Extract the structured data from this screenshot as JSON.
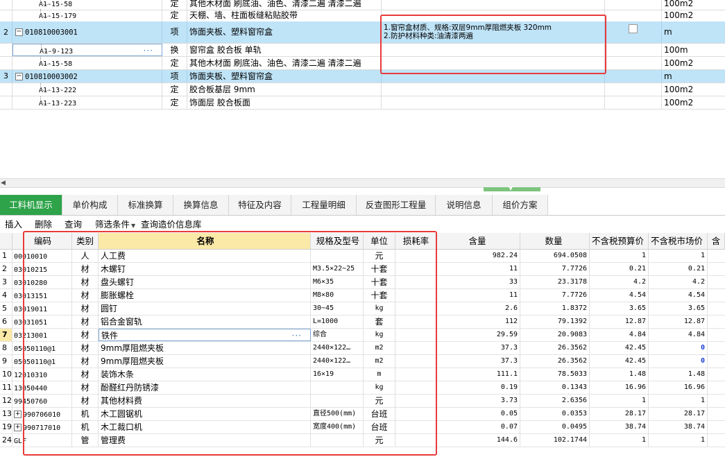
{
  "upper": {
    "rows": [
      {
        "no": "",
        "code": "A1-15-58",
        "type": "定",
        "name": "其他木材面 刷底油、油色、清漆二遍 清漆二遍",
        "feature": "",
        "unit": "100m2",
        "level": "child"
      },
      {
        "no": "",
        "code": "A1-15-179",
        "type": "定",
        "name": "天棚、墙、柱面板缝粘贴胶带",
        "feature": "",
        "unit": "100m2",
        "level": "child"
      },
      {
        "no": "2",
        "code": "010810003001",
        "type": "项",
        "name": "饰面夹板、塑料窗帘盒",
        "feature": "1.窗帘盒材质、规格:双层9mm厚阻燃夹板 320mm\n2.防护材料种类:油清漆两遍",
        "unit": "m",
        "level": "parent"
      },
      {
        "no": "",
        "code": "A1-9-123",
        "type": "换",
        "name": "窗帘盒 胶合板 单轨",
        "feature": "",
        "unit": "100m",
        "level": "child"
      },
      {
        "no": "",
        "code": "A1-15-58",
        "type": "定",
        "name": "其他木材面 刷底油、油色、清漆二遍 清漆二遍",
        "feature": "",
        "unit": "100m2",
        "level": "child"
      },
      {
        "no": "3",
        "code": "010810003002",
        "type": "项",
        "name": "饰面夹板、塑料窗帘盒",
        "feature": "",
        "unit": "m",
        "level": "parent"
      },
      {
        "no": "",
        "code": "A1-13-222",
        "type": "定",
        "name": "胶合板基层 9mm",
        "feature": "",
        "unit": "100m2",
        "level": "child"
      },
      {
        "no": "",
        "code": "A1-13-223",
        "type": "定",
        "name": "饰面层 胶合板面",
        "feature": "",
        "unit": "100m2",
        "level": "child"
      }
    ]
  },
  "tabs": [
    {
      "label": "工料机显示",
      "active": true
    },
    {
      "label": "单价构成"
    },
    {
      "label": "标准换算"
    },
    {
      "label": "换算信息"
    },
    {
      "label": "特征及内容"
    },
    {
      "label": "工程量明细"
    },
    {
      "label": "反查图形工程量"
    },
    {
      "label": "说明信息"
    },
    {
      "label": "组价方案"
    }
  ],
  "toolbar": {
    "insert": "插入",
    "delete": "删除",
    "query": "查询",
    "filter": "筛选条件",
    "price_db": "查询造价信息库"
  },
  "lower": {
    "headers": {
      "code": "编码",
      "cat": "类别",
      "name": "名称",
      "spec": "规格及型号",
      "unit": "单位",
      "loss": "损耗率",
      "qty": "含量",
      "num": "数量",
      "bud": "不含税预算价",
      "mkt": "不含税市场价",
      "tail": "含"
    },
    "rows": [
      {
        "no": "1",
        "code": "00010010",
        "cat": "人",
        "name": "人工费",
        "spec": "",
        "unit": "元",
        "qty": "982.24",
        "num": "694.0508",
        "bud": "1",
        "mkt": "1"
      },
      {
        "no": "2",
        "code": "03010215",
        "cat": "材",
        "name": "木螺钉",
        "spec": "M3.5×22~25",
        "unit": "十套",
        "qty": "11",
        "num": "7.7726",
        "bud": "0.21",
        "mkt": "0.21"
      },
      {
        "no": "3",
        "code": "03010280",
        "cat": "材",
        "name": "盘头螺钉",
        "spec": "M6×35",
        "unit": "十套",
        "qty": "33",
        "num": "23.3178",
        "bud": "4.2",
        "mkt": "4.2"
      },
      {
        "no": "4",
        "code": "03013151",
        "cat": "材",
        "name": "膨胀螺栓",
        "spec": "M8×80",
        "unit": "十套",
        "qty": "11",
        "num": "7.7726",
        "bud": "4.54",
        "mkt": "4.54"
      },
      {
        "no": "5",
        "code": "03019011",
        "cat": "材",
        "name": "圆钉",
        "spec": "30~45",
        "unit": "kg",
        "qty": "2.6",
        "num": "1.8372",
        "bud": "3.65",
        "mkt": "3.65"
      },
      {
        "no": "6",
        "code": "03031051",
        "cat": "材",
        "name": "铝合金窗轨",
        "spec": "L=1000",
        "unit": "套",
        "qty": "112",
        "num": "79.1392",
        "bud": "12.87",
        "mkt": "12.87"
      },
      {
        "no": "7",
        "code": "03213001",
        "cat": "材",
        "name": "铁件",
        "spec": "综合",
        "unit": "kg",
        "qty": "29.59",
        "num": "20.9083",
        "bud": "4.84",
        "mkt": "4.84",
        "current": true
      },
      {
        "no": "8",
        "code": "05050110@1",
        "cat": "材",
        "name": "9mm厚阻燃夹板",
        "spec": "2440×122…",
        "unit": "m2",
        "qty": "37.3",
        "num": "26.3562",
        "bud": "42.45",
        "mkt": "0",
        "mkt_blue": true
      },
      {
        "no": "9",
        "code": "05050110@1",
        "cat": "材",
        "name": "9mm厚阻燃夹板",
        "spec": "2440×122…",
        "unit": "m2",
        "qty": "37.3",
        "num": "26.3562",
        "bud": "42.45",
        "mkt": "0",
        "mkt_blue": true
      },
      {
        "no": "10",
        "code": "12010310",
        "cat": "材",
        "name": "装饰木条",
        "spec": "16×19",
        "unit": "m",
        "qty": "111.1",
        "num": "78.5033",
        "bud": "1.48",
        "mkt": "1.48"
      },
      {
        "no": "11",
        "code": "13050440",
        "cat": "材",
        "name": "酚醛红丹防锈漆",
        "spec": "",
        "unit": "kg",
        "qty": "0.19",
        "num": "0.1343",
        "bud": "16.96",
        "mkt": "16.96"
      },
      {
        "no": "12",
        "code": "99450760",
        "cat": "材",
        "name": "其他材料费",
        "spec": "",
        "unit": "元",
        "qty": "3.73",
        "num": "2.6356",
        "bud": "1",
        "mkt": "1"
      },
      {
        "no": "13",
        "code": "990706010",
        "cat": "机",
        "name": "木工圆锯机",
        "spec": "直径500(mm)",
        "unit": "台班",
        "qty": "0.05",
        "num": "0.0353",
        "bud": "28.17",
        "mkt": "28.17",
        "expand": true
      },
      {
        "no": "19",
        "code": "990717010",
        "cat": "机",
        "name": "木工裁口机",
        "spec": "宽度400(mm)",
        "unit": "台班",
        "qty": "0.07",
        "num": "0.0495",
        "bud": "38.74",
        "mkt": "38.74",
        "expand": true
      },
      {
        "no": "24",
        "code": "GLF",
        "cat": "管",
        "name": "管理费",
        "spec": "",
        "unit": "元",
        "qty": "144.6",
        "num": "102.1744",
        "bud": "1",
        "mkt": "1"
      }
    ]
  },
  "colors": {
    "accent": "#2ea34a",
    "highlight": "#bfe3f7",
    "annotation": "#e83a3a",
    "name_header": "#fbe9a8"
  }
}
